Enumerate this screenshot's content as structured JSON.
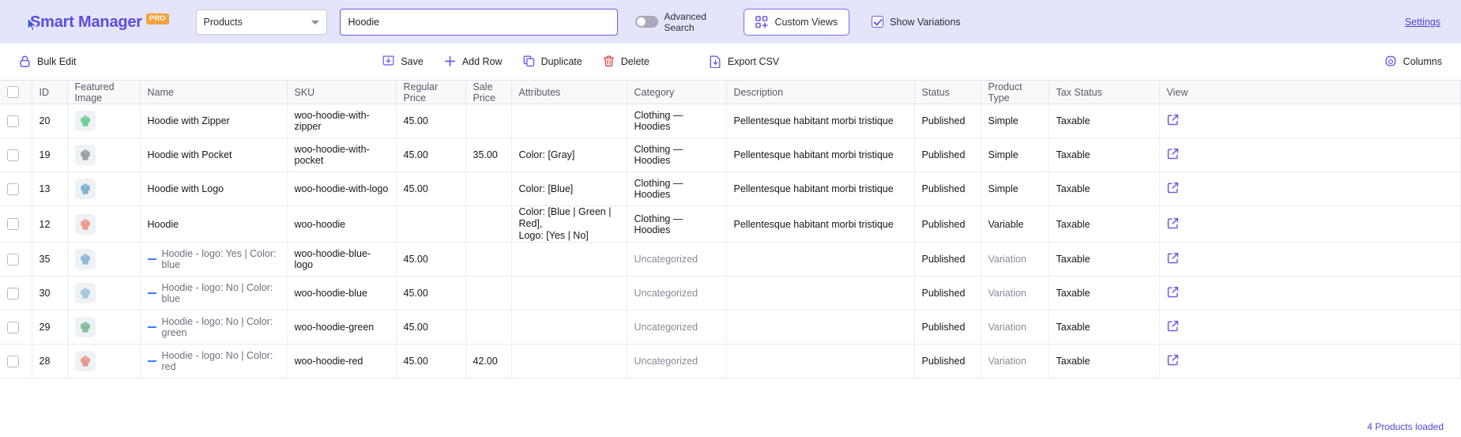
{
  "header": {
    "brand": "Smart Manager",
    "brand_badge": "PRO",
    "module_select": {
      "value": "Products",
      "icon": "chevron-down-icon"
    },
    "search": {
      "value": "Hoodie",
      "placeholder": "Search"
    },
    "advanced_search": {
      "label": "Advanced Search",
      "enabled": false
    },
    "custom_views": {
      "label": "Custom Views",
      "icon": "grid-plus-icon"
    },
    "show_variations": {
      "label": "Show Variations",
      "checked": true
    },
    "settings_link": "Settings",
    "accent": "#6c5ce7",
    "bar_bg": "#e4e4fb"
  },
  "toolbar": {
    "bulk_edit": {
      "label": "Bulk Edit",
      "icon": "lock-icon"
    },
    "save": {
      "label": "Save",
      "icon": "save-download-icon"
    },
    "add_row": {
      "label": "Add Row",
      "icon": "plus-icon"
    },
    "duplicate": {
      "label": "Duplicate",
      "icon": "copy-icon"
    },
    "delete": {
      "label": "Delete",
      "icon": "trash-icon",
      "color": "#e5484d"
    },
    "export_csv": {
      "label": "Export CSV",
      "icon": "file-download-icon"
    },
    "columns": {
      "label": "Columns",
      "icon": "gear-icon"
    }
  },
  "table": {
    "columns": [
      "",
      "ID",
      "Featured Image",
      "Name",
      "SKU",
      "Regular Price",
      "Sale Price",
      "Attributes",
      "Category",
      "Description",
      "Status",
      "Product Type",
      "Tax Status",
      "View"
    ],
    "rows": [
      {
        "id": "20",
        "thumb_color": "#6fcf97",
        "name": "Hoodie with Zipper",
        "is_variation": false,
        "sku": "woo-hoodie-with-zipper",
        "regular_price": "45.00",
        "sale_price": "",
        "attributes": "",
        "attributes_line2": "",
        "category": "Clothing — Hoodies",
        "description": "Pellentesque habitant morbi tristique",
        "status": "Published",
        "product_type": "Simple",
        "tax_status": "Taxable",
        "view_icon": "external-link-icon"
      },
      {
        "id": "19",
        "thumb_color": "#9aa0a6",
        "name": "Hoodie with Pocket",
        "is_variation": false,
        "sku": "woo-hoodie-with-pocket",
        "regular_price": "45.00",
        "sale_price": "35.00",
        "attributes": "Color: [Gray]",
        "attributes_line2": "",
        "category": "Clothing — Hoodies",
        "description": "Pellentesque habitant morbi tristique",
        "status": "Published",
        "product_type": "Simple",
        "tax_status": "Taxable",
        "view_icon": "external-link-icon"
      },
      {
        "id": "13",
        "thumb_color": "#7fb3d5",
        "name": "Hoodie with Logo",
        "is_variation": false,
        "sku": "woo-hoodie-with-logo",
        "regular_price": "45.00",
        "sale_price": "",
        "attributes": "Color: [Blue]",
        "attributes_line2": "",
        "category": "Clothing — Hoodies",
        "description": "Pellentesque habitant morbi tristique",
        "status": "Published",
        "product_type": "Simple",
        "tax_status": "Taxable",
        "view_icon": "external-link-icon"
      },
      {
        "id": "12",
        "thumb_color": "#ef9a8a",
        "name": "Hoodie",
        "is_variation": false,
        "sku": "woo-hoodie",
        "regular_price": "",
        "sale_price": "",
        "attributes": "Color: [Blue | Green | Red],",
        "attributes_line2": "Logo: [Yes | No]",
        "category": "Clothing — Hoodies",
        "description": "Pellentesque habitant morbi tristique",
        "status": "Published",
        "product_type": "Variable",
        "tax_status": "Taxable",
        "view_icon": "external-link-icon"
      },
      {
        "id": "35",
        "thumb_color": "#8fb8d8",
        "name": "Hoodie - logo: Yes | Color: blue",
        "is_variation": true,
        "sku": "woo-hoodie-blue-logo",
        "regular_price": "45.00",
        "sale_price": "",
        "attributes": "",
        "attributes_line2": "",
        "category": "Uncategorized",
        "description": "",
        "status": "Published",
        "product_type": "Variation",
        "tax_status": "Taxable",
        "view_icon": "external-link-icon"
      },
      {
        "id": "30",
        "thumb_color": "#a8c6de",
        "name": "Hoodie - logo: No | Color: blue",
        "is_variation": true,
        "sku": "woo-hoodie-blue",
        "regular_price": "45.00",
        "sale_price": "",
        "attributes": "",
        "attributes_line2": "",
        "category": "Uncategorized",
        "description": "",
        "status": "Published",
        "product_type": "Variation",
        "tax_status": "Taxable",
        "view_icon": "external-link-icon"
      },
      {
        "id": "29",
        "thumb_color": "#7fbf9a",
        "name": "Hoodie - logo: No | Color: green",
        "is_variation": true,
        "sku": "woo-hoodie-green",
        "regular_price": "45.00",
        "sale_price": "",
        "attributes": "",
        "attributes_line2": "",
        "category": "Uncategorized",
        "description": "",
        "status": "Published",
        "product_type": "Variation",
        "tax_status": "Taxable",
        "view_icon": "external-link-icon"
      },
      {
        "id": "28",
        "thumb_color": "#e89a8c",
        "name": "Hoodie - logo: No | Color: red",
        "is_variation": true,
        "sku": "woo-hoodie-red",
        "regular_price": "45.00",
        "sale_price": "42.00",
        "attributes": "",
        "attributes_line2": "",
        "category": "Uncategorized",
        "description": "",
        "status": "Published",
        "product_type": "Variation",
        "tax_status": "Taxable",
        "view_icon": "external-link-icon"
      }
    ]
  },
  "footer": {
    "status": "4 Products loaded"
  }
}
